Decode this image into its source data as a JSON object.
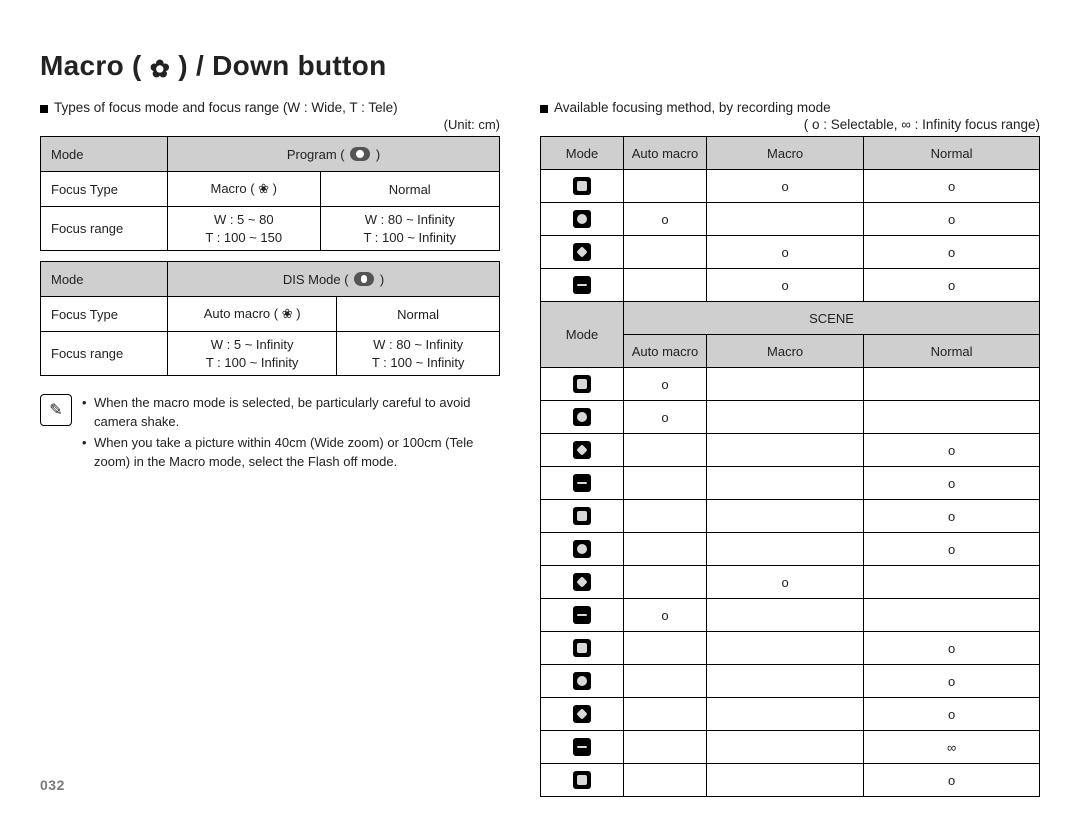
{
  "title_a": "Macro ( ",
  "title_b": " ) / Down button",
  "title_icon": "macro-flower-icon",
  "left": {
    "heading": "Types of focus mode and focus range (W : Wide, T : Tele)",
    "unit": "(Unit: cm)",
    "blocks": [
      {
        "mode_label": "Mode",
        "mode_value": "Program ( ",
        "mode_value_after": " )",
        "mode_icon": "camera-pill-icon",
        "focus_type_label": "Focus Type",
        "focus_types": [
          "Macro ( ❀ )",
          "Normal"
        ],
        "focus_range_label": "Focus range",
        "ranges_a": [
          "W : 5 ~ 80",
          "T : 100 ~ 150"
        ],
        "ranges_b": [
          "W : 80 ~ Infinity",
          "T : 100 ~ Infinity"
        ]
      },
      {
        "mode_label": "Mode",
        "mode_value": "DIS Mode ( ",
        "mode_value_after": " )",
        "mode_icon": "hand-pill-icon",
        "focus_type_label": "Focus Type",
        "focus_types": [
          "Auto macro ( ❀ )",
          "Normal"
        ],
        "focus_range_label": "Focus range",
        "ranges_a": [
          "W : 5 ~ Infinity",
          "T : 100 ~ Infinity"
        ],
        "ranges_b": [
          "W : 80 ~ Infinity",
          "T : 100 ~ Infinity"
        ]
      }
    ],
    "notes": [
      "When the macro mode is selected, be particularly careful to avoid camera shake.",
      "When you take a picture within 40cm (Wide zoom) or 100cm (Tele zoom) in the Macro mode, select the Flash off mode."
    ],
    "note_icon": "note-pencil-icon"
  },
  "right": {
    "heading": "Available focusing method, by recording mode",
    "legend": "( o : Selectable, ∞ : Infinity focus range)",
    "head": {
      "mode": "Mode",
      "auto": "Auto macro",
      "macro": "Macro",
      "normal": "Normal"
    },
    "top_rows": [
      {
        "icon": "mode-ic v1",
        "auto": "",
        "macro": "o",
        "normal": "o"
      },
      {
        "icon": "mode-ic v2",
        "auto": "o",
        "macro": "",
        "normal": "o"
      },
      {
        "icon": "mode-ic v3",
        "auto": "",
        "macro": "o",
        "normal": "o"
      },
      {
        "icon": "mode-ic v4",
        "auto": "",
        "macro": "o",
        "normal": "o"
      }
    ],
    "scene_label": "SCENE",
    "scene_head": {
      "mode": "Mode",
      "auto": "Auto macro",
      "macro": "Macro",
      "normal": "Normal"
    },
    "scene_rows": [
      {
        "auto": "o",
        "macro": "",
        "normal": ""
      },
      {
        "auto": "o",
        "macro": "",
        "normal": ""
      },
      {
        "auto": "",
        "macro": "",
        "normal": "o"
      },
      {
        "auto": "",
        "macro": "",
        "normal": "o"
      },
      {
        "auto": "",
        "macro": "",
        "normal": "o"
      },
      {
        "auto": "",
        "macro": "",
        "normal": "o"
      },
      {
        "auto": "",
        "macro": "o",
        "normal": ""
      },
      {
        "auto": "o",
        "macro": "",
        "normal": ""
      },
      {
        "auto": "",
        "macro": "",
        "normal": "o"
      },
      {
        "auto": "",
        "macro": "",
        "normal": "o"
      },
      {
        "auto": "",
        "macro": "",
        "normal": "o"
      },
      {
        "auto": "",
        "macro": "",
        "normal": "∞"
      },
      {
        "auto": "",
        "macro": "",
        "normal": "o"
      }
    ]
  },
  "page_number": "032"
}
